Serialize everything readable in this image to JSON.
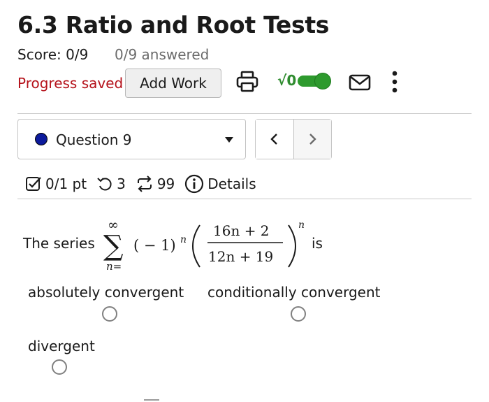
{
  "header": {
    "title": "6.3 Ratio and Root Tests",
    "score": "Score: 0/9",
    "answered": "0/9 answered",
    "progress": "Progress saved",
    "add_work": "Add Work",
    "sqrt_label": "√0",
    "toggle_on": true,
    "accent_color": "#2e9a2e",
    "progress_color": "#b5121b",
    "icons": [
      "print-icon",
      "sqrt-toggle",
      "mail-icon",
      "more-vertical-icon"
    ]
  },
  "question_nav": {
    "selected": "Question 9",
    "status_color": "#0c1a9c",
    "prev_icon": "chevron-left-icon",
    "next_icon": "chevron-right-icon"
  },
  "meta": {
    "points": "0/1 pt",
    "retries": "3",
    "submissions": "99",
    "details": "Details"
  },
  "question": {
    "prefix": "The series",
    "sum_upper": "∞",
    "sum_lower": "n=",
    "factor": "( − 1)",
    "factor_exp": "n",
    "numerator": "16n + 2",
    "denominator": "12n + 19",
    "outer_exp": "n",
    "suffix": "is"
  },
  "options": [
    {
      "label": "absolutely convergent",
      "selected": false
    },
    {
      "label": "conditionally convergent",
      "selected": false
    },
    {
      "label": "divergent",
      "selected": false
    }
  ]
}
